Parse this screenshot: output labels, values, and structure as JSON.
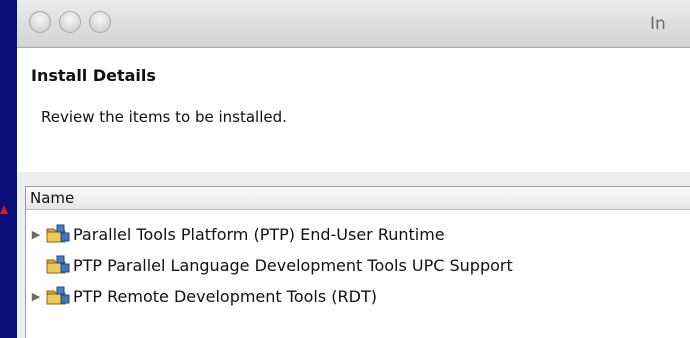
{
  "window": {
    "title": "In"
  },
  "header": {
    "title": "Install Details",
    "subtitle": "Review the items to be installed."
  },
  "tree": {
    "column_name": "Name",
    "items": [
      {
        "label": "Parallel Tools Platform (PTP) End-User Runtime",
        "expandable": true
      },
      {
        "label": "PTP Parallel Language Development Tools UPC Support",
        "expandable": false
      },
      {
        "label": "PTP Remote Development Tools (RDT)",
        "expandable": true
      }
    ]
  },
  "colors": {
    "background": "#0c0c78",
    "accent_red": "#d42020"
  },
  "icons": {
    "expander": "triangle-right-icon",
    "feature": "feature-package-icon"
  }
}
